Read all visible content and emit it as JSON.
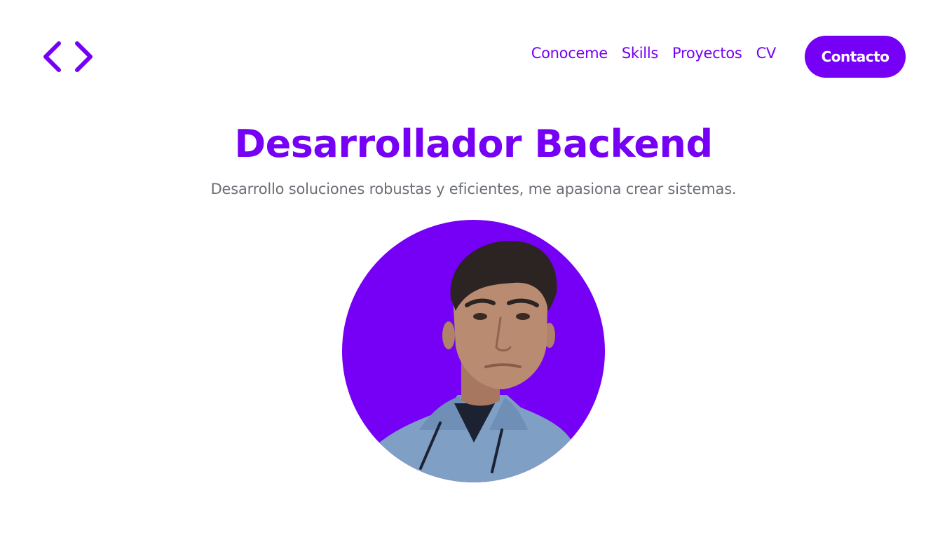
{
  "header": {
    "logo_icon": "code-brackets-icon",
    "nav_items": [
      {
        "label": "Conoceme"
      },
      {
        "label": "Skills"
      },
      {
        "label": "Proyectos"
      },
      {
        "label": "CV"
      }
    ],
    "contact_label": "Contacto"
  },
  "hero": {
    "title": "Desarrollador Backend",
    "subtitle": "Desarrollo soluciones robustas y eficientes, me apasiona crear sistemas.",
    "avatar": "profile-photo"
  },
  "colors": {
    "accent": "#7600f5",
    "subtitle": "#6b6f75",
    "hoodie": "#7f9fc4",
    "skin": "#b98c72",
    "hair": "#2b2422"
  }
}
